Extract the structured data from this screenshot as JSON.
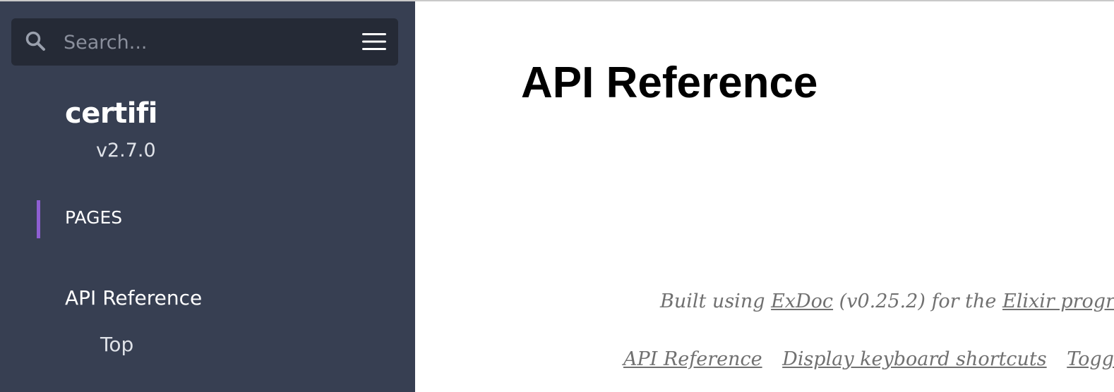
{
  "colors": {
    "sidebar_bg": "#373f52",
    "search_bg": "#252a36",
    "accent": "#8e5fd2",
    "footer_text": "#707070"
  },
  "sidebar": {
    "search": {
      "placeholder": "Search...",
      "icon": "search-icon"
    },
    "menu_icon": "hamburger-menu-icon",
    "project": {
      "name": "certifi",
      "version": "v2.7.0"
    },
    "tab_pages": "PAGES",
    "nav": {
      "api_reference": "API Reference",
      "top": "Top"
    }
  },
  "main": {
    "title": "API Reference",
    "footer": {
      "built_prefix": "Built using",
      "exdoc_link": "ExDoc",
      "built_middle": "(v0.25.2) for the",
      "elixir_link": "Elixir programming language",
      "links": [
        "API Reference",
        "Display keyboard shortcuts",
        "Toggle night mode"
      ]
    }
  }
}
